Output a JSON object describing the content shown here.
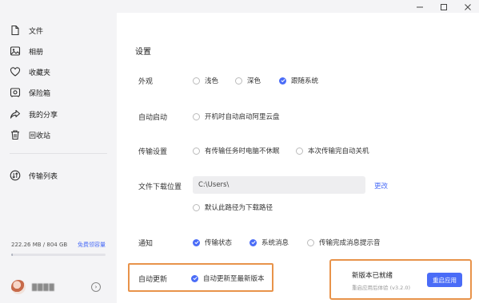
{
  "sidebar": {
    "items": [
      {
        "label": "文件",
        "icon": "file-icon"
      },
      {
        "label": "相册",
        "icon": "photo-icon"
      },
      {
        "label": "收藏夹",
        "icon": "heart-icon"
      },
      {
        "label": "保险箱",
        "icon": "safe-icon"
      },
      {
        "label": "我的分享",
        "icon": "share-icon"
      },
      {
        "label": "回收站",
        "icon": "trash-icon"
      }
    ],
    "transfer": {
      "label": "传输列表",
      "icon": "transfer-icon"
    },
    "storage": {
      "used_text": "222.26 MB / 804 GB",
      "link": "免费领容量",
      "fraction_used": 0.0003
    },
    "user": {
      "name": "████"
    }
  },
  "settings": {
    "title": "设置",
    "appearance": {
      "label": "外观",
      "options": [
        "浅色",
        "深色",
        "跟随系统"
      ],
      "selected": "跟随系统"
    },
    "autostart": {
      "label": "自动启动",
      "option": "开机时自动启动阿里云盘",
      "checked": false
    },
    "transfer": {
      "label": "传输设置",
      "option1": "有传输任务时电脑不休眠",
      "option2": "本次传输完自动关机"
    },
    "download": {
      "label": "文件下载位置",
      "path": "C:\\Users\\",
      "change": "更改",
      "default_option": "默认此路径为下载路径"
    },
    "notify": {
      "label": "通知",
      "options": [
        "传输状态",
        "系统消息",
        "传输完成消息提示音"
      ]
    },
    "update": {
      "label": "自动更新",
      "option": "自动更新至最新版本"
    }
  },
  "toast": {
    "title": "新版本已就绪",
    "subtitle": "重启应用后体验 (v3.2.0)",
    "button": "重启应用"
  },
  "colors": {
    "accent": "#4a6cf7",
    "highlight": "#e8934a"
  }
}
